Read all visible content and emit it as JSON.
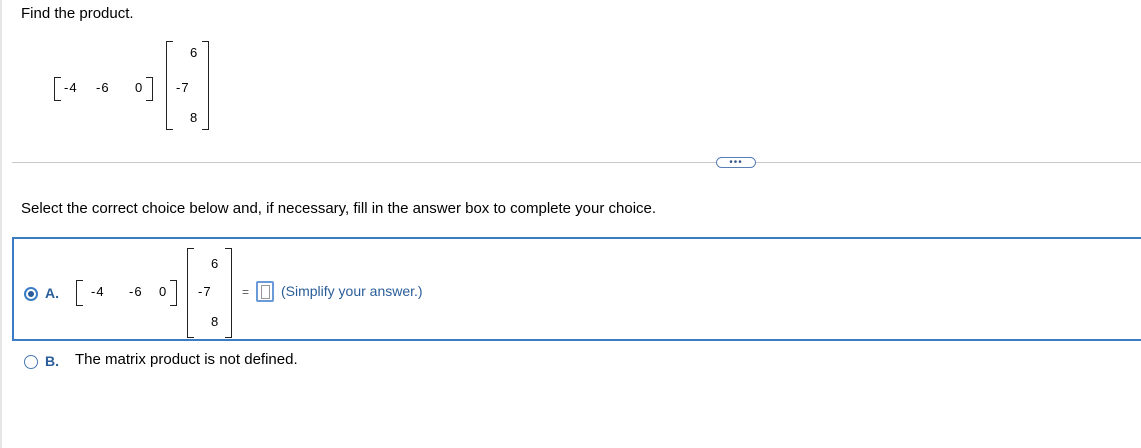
{
  "question": {
    "prompt": "Find the product.",
    "row_matrix": [
      "-4",
      "-6",
      "0"
    ],
    "column_matrix": [
      "6",
      "-7",
      "8"
    ]
  },
  "ui": {
    "more_button": "•••"
  },
  "instruction": "Select the correct choice below and, if necessary, fill in the answer box to complete your choice.",
  "choices": [
    {
      "letter": "A.",
      "selected": true,
      "row_matrix": [
        "-4",
        "-6",
        "0"
      ],
      "column_matrix": [
        "6",
        "-7",
        "8"
      ],
      "equals": "=",
      "answer_value": "",
      "hint": "(Simplify your answer.)"
    },
    {
      "letter": "B.",
      "selected": false,
      "text": "The matrix product is not defined."
    }
  ],
  "colors": {
    "accent": "#3b7dc4",
    "link": "#2a5d99"
  }
}
